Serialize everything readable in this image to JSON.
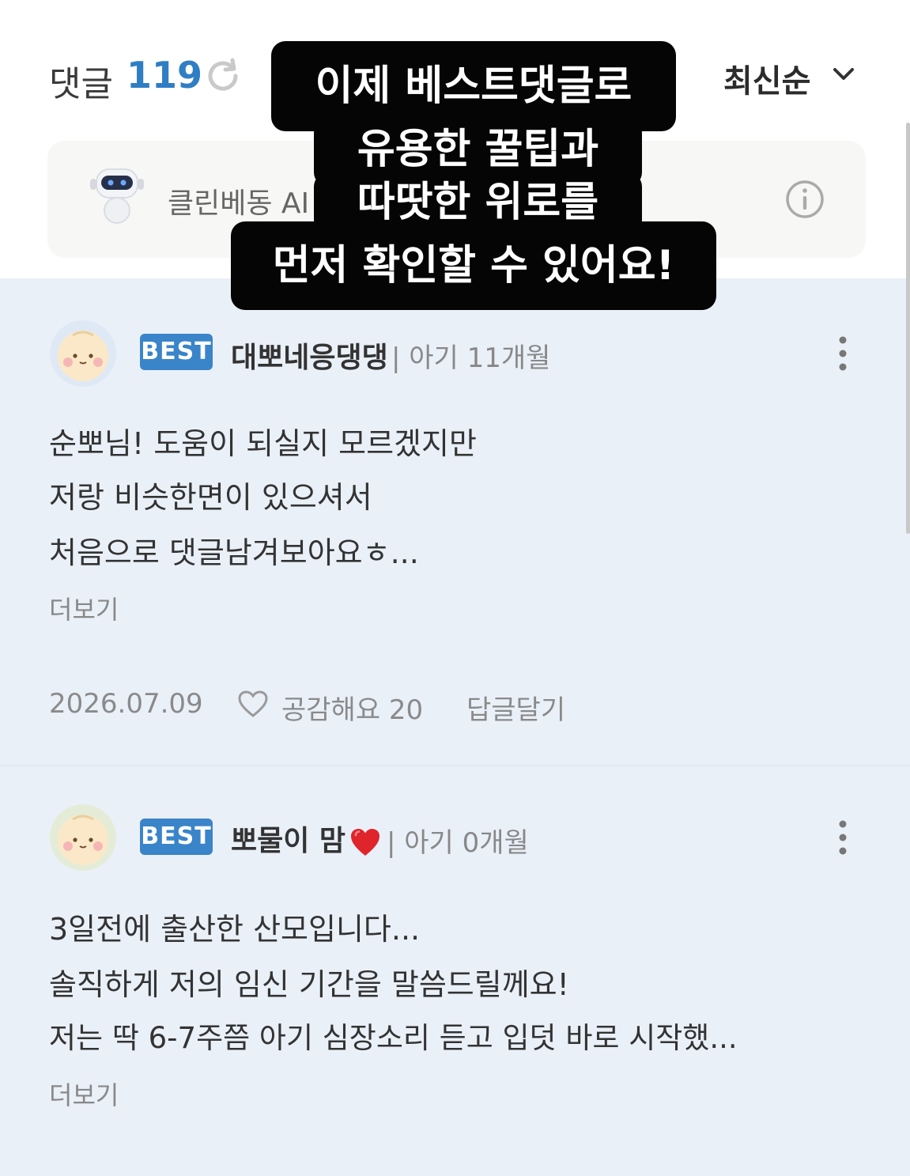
{
  "header": {
    "title": "댓글",
    "count": "119",
    "sort_label": "최신순"
  },
  "ai_bar": {
    "label": "클린베동 AI"
  },
  "overlay": {
    "lines": [
      "이제 베스트댓글로",
      "유용한 꿀팁과",
      "따땃한 위로를",
      "먼저 확인할 수 있어요!"
    ]
  },
  "comments": [
    {
      "badge": "BEST",
      "nickname": "대뽀네응댕댕",
      "age": "| 아기 11개월",
      "lines": [
        "순뽀님! 도움이 되실지 모르겠지만",
        "저랑 비슷한면이 있으셔서",
        "처음으로 댓글남겨보아요ㅎ..."
      ],
      "more_label": "더보기",
      "date": "2026.07.09",
      "like_label": "공감해요 20",
      "reply_label": "답글달기"
    },
    {
      "badge": "BEST",
      "nickname": "뽀물이 맘",
      "age": "| 아기 0개월",
      "lines": [
        "3일전에 출산한 산모입니다...",
        "솔직하게 저의 임신 기간을 말씀드릴께요!",
        "저는 딱 6-7주쯤 아기 심장소리 듣고 입덧 바로 시작했..."
      ],
      "more_label": "더보기"
    }
  ],
  "colors": {
    "accent_blue": "#2f7ec4",
    "badge_blue": "#3a84c9",
    "list_background": "#eaf0f8",
    "heart_red": "#e0242c"
  },
  "icons": [
    "refresh-icon",
    "chevron-down-icon",
    "robot-icon",
    "info-icon",
    "more-vertical-icon",
    "heart-outline-icon",
    "heart-red-icon",
    "baby-avatar-icon"
  ]
}
